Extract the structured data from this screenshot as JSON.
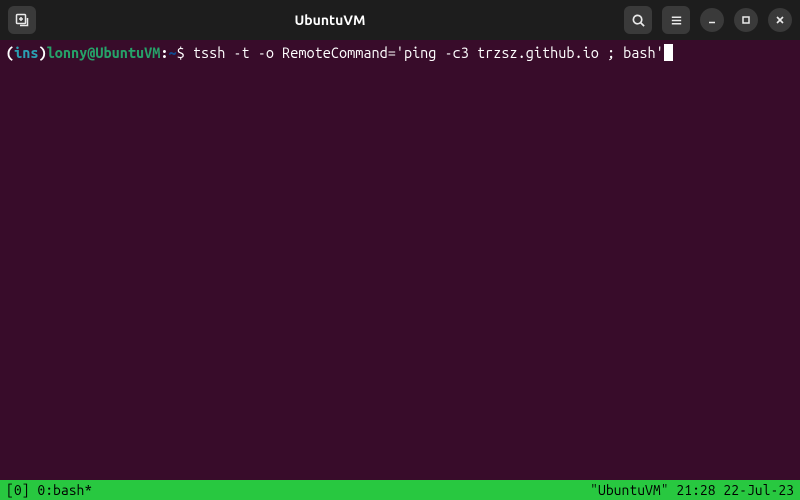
{
  "titlebar": {
    "title": "UbuntuVM"
  },
  "prompt": {
    "open_paren": "(",
    "ins": "ins",
    "close_paren": ")",
    "user": "lonny",
    "at": "@",
    "host": "UbuntuVM",
    "colon": ":",
    "path": "~",
    "dollar": "$ ",
    "command": "tssh -t -o RemoteCommand='ping -c3 trzsz.github.io ; bash'"
  },
  "statusbar": {
    "left": "[0] 0:bash*",
    "right": "\"UbuntuVM\" 21:28 22-Jul-23"
  }
}
